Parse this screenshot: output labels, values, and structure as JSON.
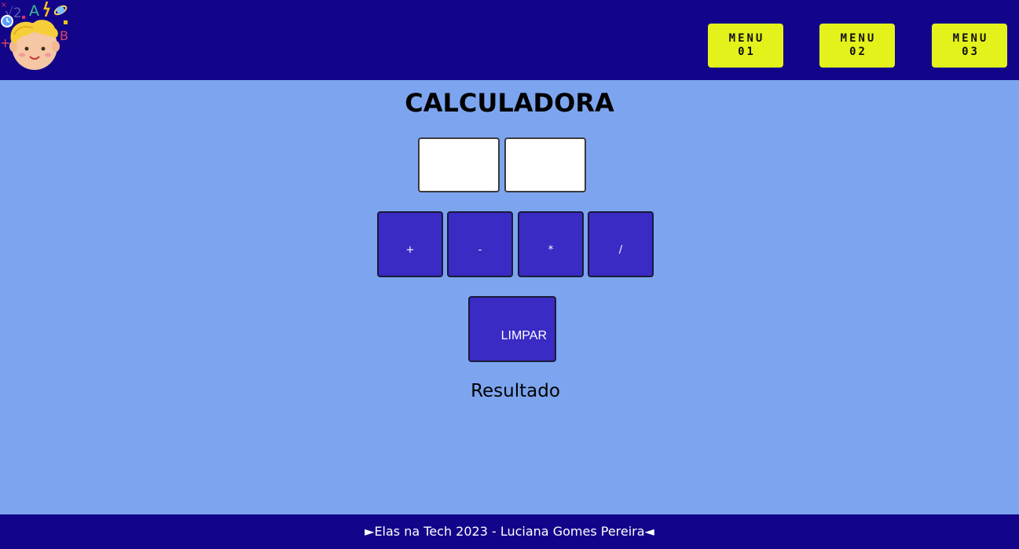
{
  "header": {
    "menus": [
      {
        "line1": "MENU",
        "line2": "01"
      },
      {
        "line1": "MENU",
        "line2": "02"
      },
      {
        "line1": "MENU",
        "line2": "03"
      }
    ],
    "logo_letters": {
      "a": "A",
      "b": "B",
      "root": "√2"
    }
  },
  "main": {
    "title": "CALCULADORA",
    "inputs": [
      {
        "value": ""
      },
      {
        "value": ""
      }
    ],
    "operations": [
      "+",
      "-",
      "*",
      "/"
    ],
    "clear_label": "LIMPAR",
    "result_label": "Resultado"
  },
  "footer": {
    "text": "►Elas na Tech 2023 - Luciana Gomes Pereira◄"
  },
  "colors": {
    "header_bg": "#13058a",
    "page_bg": "#7da5ef",
    "menu_bg": "#e4f21c",
    "button_bg": "#3a2bc4"
  }
}
